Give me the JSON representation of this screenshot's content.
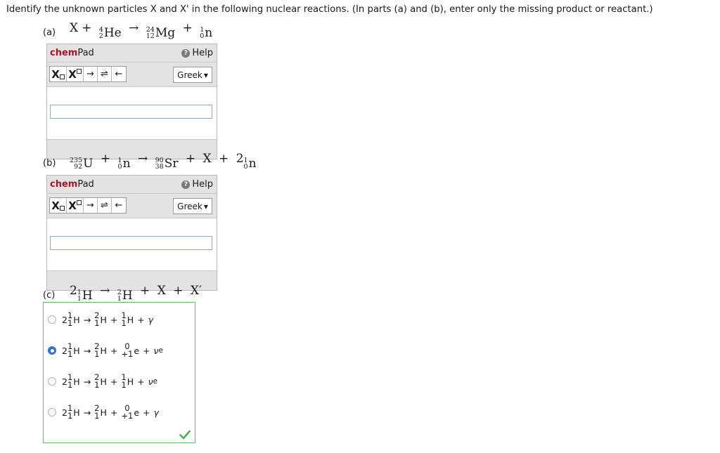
{
  "question": "Identify the unknown particles X and X' in the following nuclear reactions. (In parts (a) and (b), enter only the missing product or reactant.)",
  "parts": {
    "a": {
      "label": "(a)",
      "eq": {
        "x": "X",
        "plus1": "+",
        "he_mass": "4",
        "he_num": "2",
        "he": "He",
        "arrow": "→",
        "mg_mass": "24",
        "mg_num": "12",
        "mg": "Mg",
        "plus2": "+",
        "n_mass": "1",
        "n_num": "0",
        "n": "n"
      }
    },
    "b": {
      "label": "(b)",
      "eq": {
        "u_mass": "235",
        "u_num": "92",
        "u": "U",
        "plus1": "+",
        "n_mass": "1",
        "n_num": "0",
        "n": "n",
        "arrow": "→",
        "sr_mass": "90",
        "sr_num": "38",
        "sr": "Sr",
        "plus2": "+",
        "x": "X",
        "plus3": "+",
        "coef": "2",
        "n2_mass": "1",
        "n2_num": "0",
        "n2": "n"
      }
    },
    "c": {
      "label": "(c)",
      "eq": {
        "coef": "2",
        "h_mass": "1",
        "h_num": "1",
        "h": "H",
        "arrow": "→",
        "h2_mass": "2",
        "h2_num": "1",
        "h2": "H",
        "plus1": "+",
        "x": "X",
        "plus2": "+",
        "xp": "X′"
      }
    }
  },
  "chempad": {
    "title_bold": "chem",
    "title_rest": "Pad",
    "help": "Help",
    "help_icon": "?",
    "tool_sub": "X",
    "tool_sup": "X",
    "tool_arrow": "→",
    "tool_equil": "⇌",
    "tool_back": "←",
    "greek": "Greek",
    "greek_caret": "▾",
    "input_a": "",
    "input_b": ""
  },
  "options": [
    {
      "coef": "2",
      "r_top": "1",
      "r_bot": "1",
      "r_sym": "H",
      "arrow": "→",
      "p_top": "2",
      "p_bot": "1",
      "p_sym": "H",
      "plus1": "+",
      "q_top": "1",
      "q_bot": "1",
      "q_sym": "H",
      "plus2": "+",
      "last": "γ",
      "last_sub": "",
      "selected": false
    },
    {
      "coef": "2",
      "r_top": "1",
      "r_bot": "1",
      "r_sym": "H",
      "arrow": "→",
      "p_top": "2",
      "p_bot": "1",
      "p_sym": "H",
      "plus1": "+",
      "q_top": "0",
      "q_bot": "+1",
      "q_sym": "e",
      "plus2": "+",
      "last": "ν",
      "last_sub": "e",
      "selected": true
    },
    {
      "coef": "2",
      "r_top": "1",
      "r_bot": "1",
      "r_sym": "H",
      "arrow": "→",
      "p_top": "2",
      "p_bot": "1",
      "p_sym": "H",
      "plus1": "+",
      "q_top": "1",
      "q_bot": "1",
      "q_sym": "H",
      "plus2": "+",
      "last": "ν",
      "last_sub": "e",
      "selected": false
    },
    {
      "coef": "2",
      "r_top": "1",
      "r_bot": "1",
      "r_sym": "H",
      "arrow": "→",
      "p_top": "2",
      "p_bot": "1",
      "p_sym": "H",
      "plus1": "+",
      "q_top": "0",
      "q_bot": "+1",
      "q_sym": "e",
      "plus2": "+",
      "last": "γ",
      "last_sub": "",
      "selected": false
    }
  ],
  "status": {
    "correct_icon": "checkmark-icon",
    "correct_color": "#4caf50"
  },
  "colors": {
    "brand": "#a8142b",
    "selected_radio": "#2f73d6",
    "answer_border": "#6fb96f"
  }
}
